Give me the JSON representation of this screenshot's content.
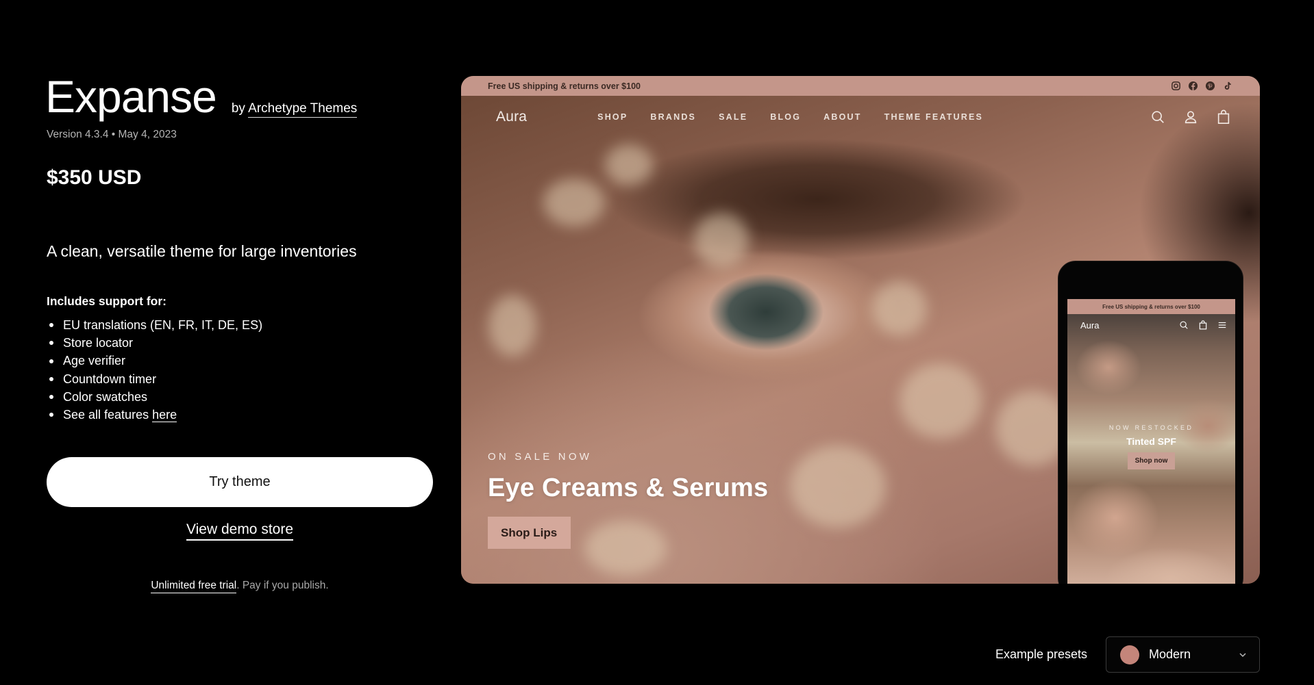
{
  "theme": {
    "name": "Expanse",
    "by_prefix": "by",
    "author": "Archetype Themes",
    "version_line": "Version 4.3.4 • May 4, 2023",
    "price": "$350 USD",
    "tagline": "A clean, versatile theme for large inventories",
    "includes_heading": "Includes support for:",
    "features": [
      "EU translations (EN, FR, IT, DE, ES)",
      "Store locator",
      "Age verifier",
      "Countdown timer",
      "Color swatches"
    ],
    "see_all_prefix": "See all features",
    "see_all_link": "here"
  },
  "actions": {
    "try_theme": "Try theme",
    "view_demo": "View demo store",
    "trial_link": "Unlimited free trial",
    "trial_rest": ". Pay if you publish."
  },
  "preview": {
    "announcement": "Free US shipping & returns over $100",
    "socials": [
      "instagram-icon",
      "facebook-icon",
      "pinterest-icon",
      "tiktok-icon"
    ],
    "store_logo": "Aura",
    "nav": [
      "SHOP",
      "BRANDS",
      "SALE",
      "BLOG",
      "ABOUT",
      "THEME FEATURES"
    ],
    "nav_icons": [
      "search-icon",
      "account-icon",
      "cart-icon"
    ],
    "hero_kicker": "ON SALE NOW",
    "hero_title": "Eye Creams & Serums",
    "hero_button": "Shop Lips",
    "accent_color": "#c4968a",
    "mobile": {
      "announcement": "Free US shipping & returns over $100",
      "logo": "Aura",
      "kicker": "NOW RESTOCKED",
      "title": "Tinted SPF",
      "button": "Shop now"
    }
  },
  "presets": {
    "label": "Example presets",
    "selected": "Modern",
    "swatch_color": "#c4857a"
  }
}
